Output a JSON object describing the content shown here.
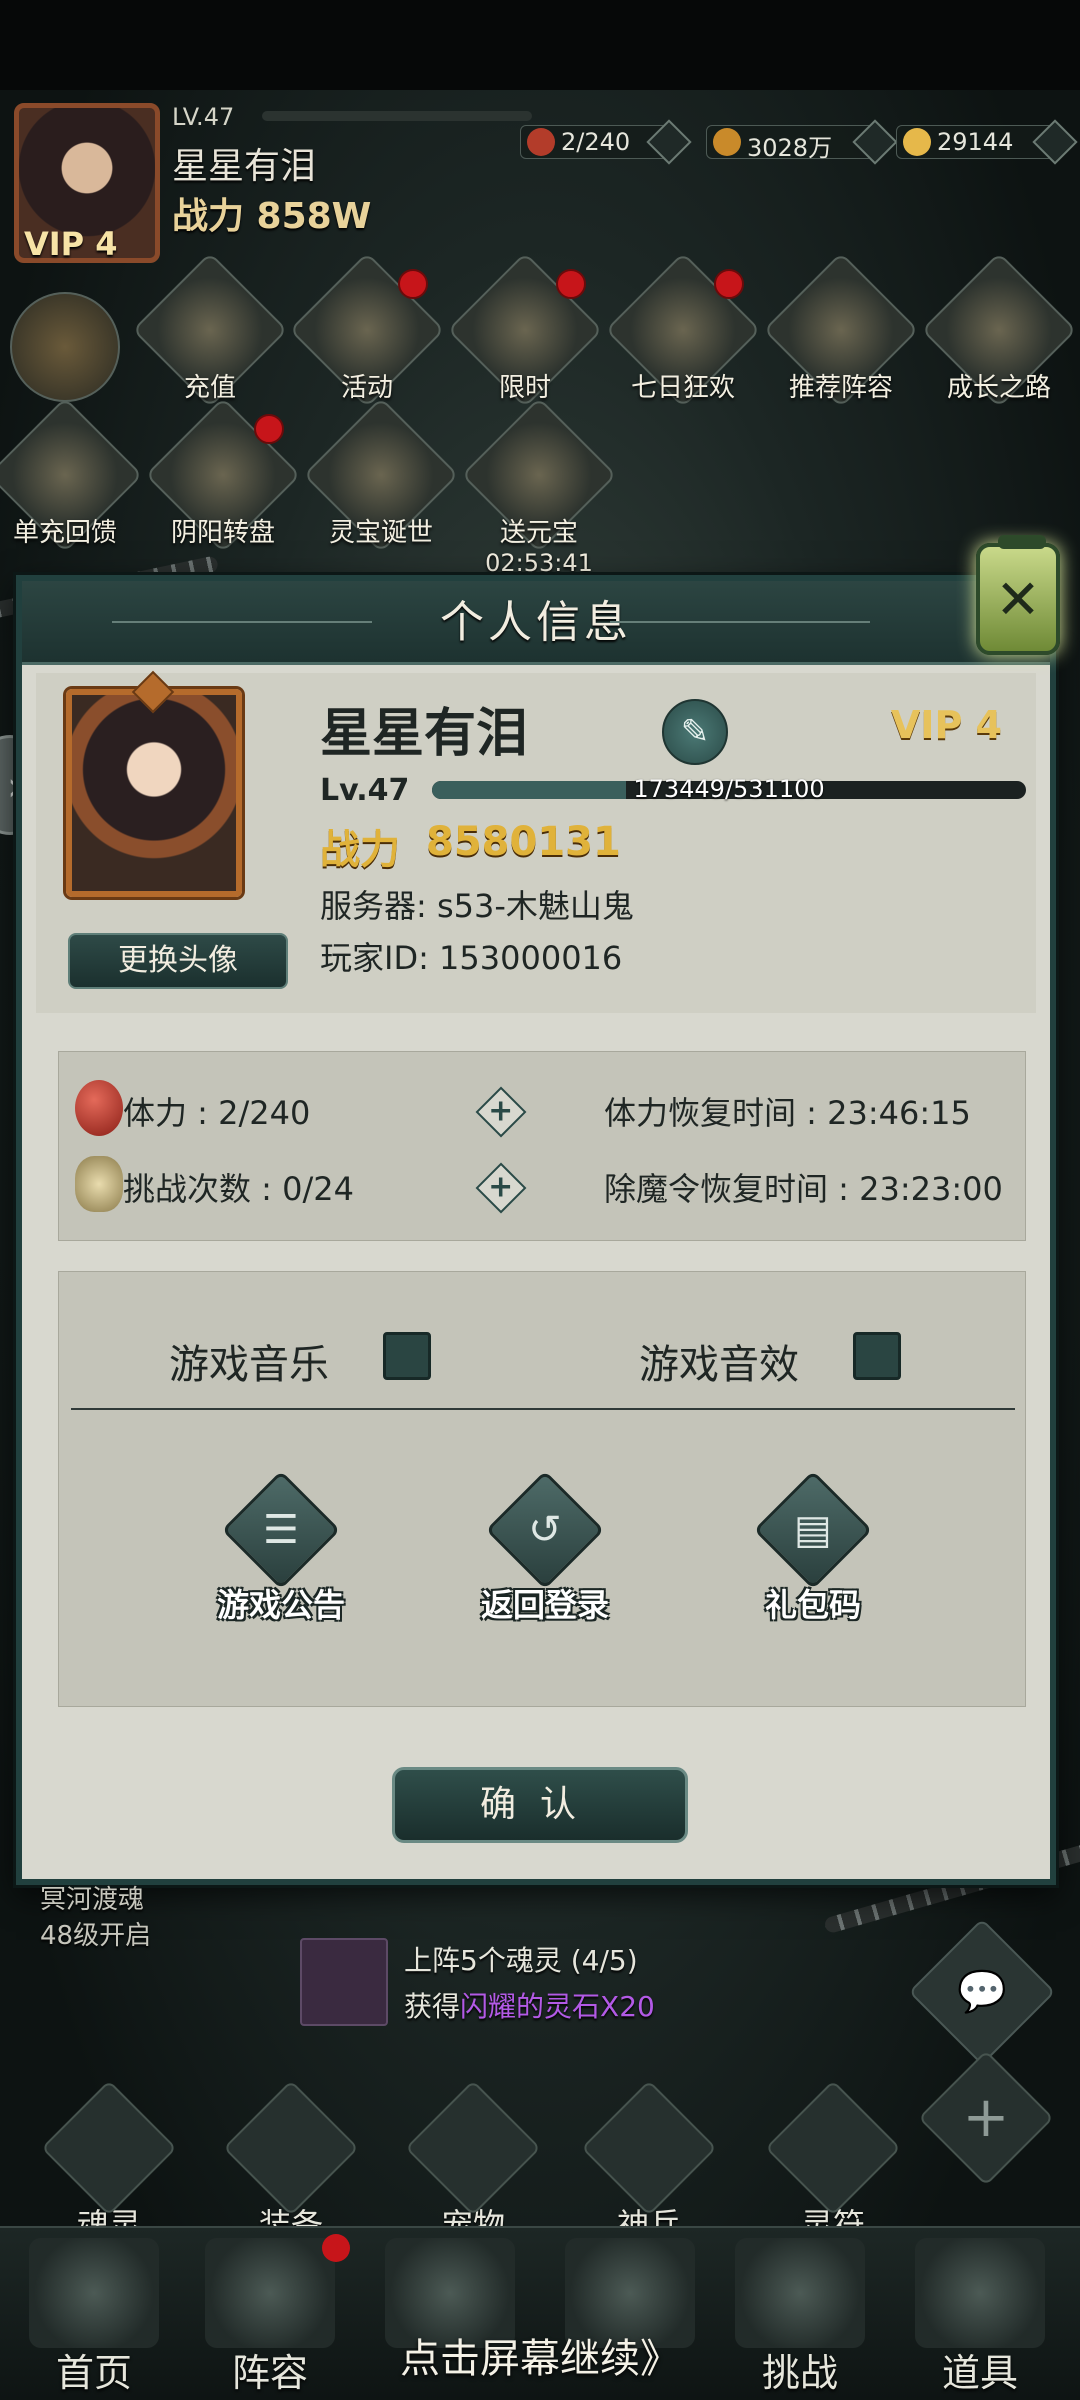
{
  "top": {
    "level": "LV.47",
    "player_name": "星星有泪",
    "power": "战力 858W",
    "vip": "VIP 4",
    "resources": [
      {
        "icon": "stamina-orb-icon",
        "value": "2/240",
        "color": "#b33c2a"
      },
      {
        "icon": "copper-coin-icon",
        "value": "3028万",
        "color": "#c98a2a"
      },
      {
        "icon": "gold-ingot-icon",
        "value": "29144",
        "color": "#e6b84a"
      }
    ]
  },
  "activities": [
    {
      "label": "充值",
      "dot": false
    },
    {
      "label": "活动",
      "dot": true
    },
    {
      "label": "限时",
      "dot": true
    },
    {
      "label": "七日狂欢",
      "dot": true
    },
    {
      "label": "推荐阵容",
      "dot": false
    },
    {
      "label": "成长之路",
      "dot": false
    },
    {
      "label": "单充回馈",
      "dot": false
    },
    {
      "label": "阴阳转盘",
      "dot": true
    },
    {
      "label": "灵宝诞世",
      "dot": false
    },
    {
      "label": "送元宝",
      "dot": false,
      "timer": "02:53:41"
    }
  ],
  "dialog": {
    "title": "个人信息",
    "close_icon": "close-icon",
    "change_avatar": "更换头像",
    "name": "星星有泪",
    "vip": "VIP 4",
    "level": "Lv.47",
    "exp_text": "173449/531100",
    "exp_fraction": 0.3266,
    "power_label": "战力",
    "power_value": "8580131",
    "server": "服务器: s53-木魅山鬼",
    "player_id": "玩家ID: 153000016",
    "stamina": "体力 : 2/240",
    "stamina_recover": "体力恢复时间 : 23:46:15",
    "challenges": "挑战次数 : 0/24",
    "demon_recover": "除魔令恢复时间 : 23:23:00",
    "music_label": "游戏音乐",
    "sfx_label": "游戏音效",
    "buttons": [
      {
        "label": "游戏公告",
        "icon": "announcement-icon"
      },
      {
        "label": "返回登录",
        "icon": "return-login-icon"
      },
      {
        "label": "礼包码",
        "icon": "gift-code-icon"
      }
    ],
    "confirm": "确认"
  },
  "lower": {
    "unlock_line1": "冥河渡魂",
    "unlock_line2": "48级开启",
    "quest_line1": "上阵5个魂灵 (4/5)",
    "quest_prefix": "获得",
    "quest_reward": "闪耀的灵石X20",
    "sub_nav": [
      "魂灵",
      "装备",
      "宠物",
      "神兵",
      "灵符"
    ],
    "bottom_nav": [
      "首页",
      "阵容",
      "",
      "",
      "挑战",
      "道具"
    ],
    "continue": "点击屏幕继续》"
  }
}
